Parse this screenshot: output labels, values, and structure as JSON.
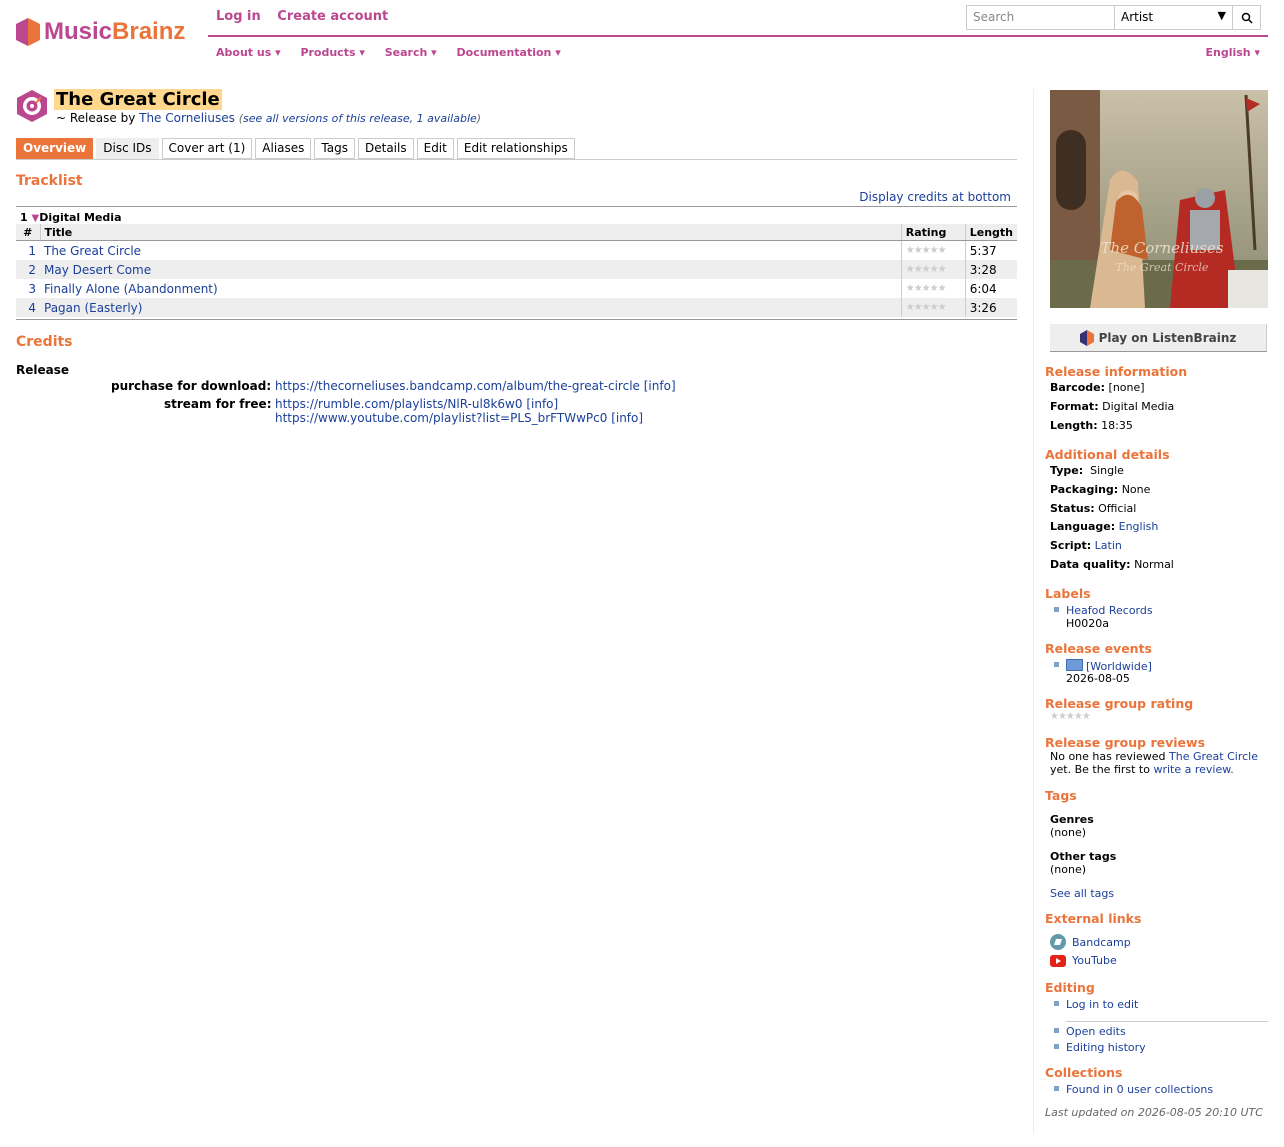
{
  "header": {
    "logo_part1": "Music",
    "logo_part2": "Brainz",
    "login": "Log in",
    "create_account": "Create account",
    "search_placeholder": "Search",
    "search_type": "Artist",
    "menu": [
      "About us ▾",
      "Products ▾",
      "Search ▾",
      "Documentation ▾"
    ],
    "language": "English ▾"
  },
  "release": {
    "title": "The Great Circle",
    "by_prefix": "~ Release by",
    "artist": "The Corneliuses",
    "versions": "see all versions of this release, 1 available",
    "tabs": [
      "Overview",
      "Disc IDs",
      "Cover art (1)",
      "Aliases",
      "Tags",
      "Details",
      "Edit",
      "Edit relationships"
    ]
  },
  "tracklist": {
    "heading": "Tracklist",
    "display_credits": "Display credits at bottom",
    "medium_num": "1",
    "medium_format": "Digital Media",
    "col_num": "#",
    "col_title": "Title",
    "col_rating": "Rating",
    "col_length": "Length",
    "stars": "★★★★★",
    "tracks": [
      {
        "num": "1",
        "title": "The Great Circle",
        "length": "5:37"
      },
      {
        "num": "2",
        "title": "May Desert Come",
        "length": "3:28"
      },
      {
        "num": "3",
        "title": "Finally Alone (Abandonment)",
        "length": "6:04"
      },
      {
        "num": "4",
        "title": "Pagan (Easterly)",
        "length": "3:26"
      }
    ]
  },
  "credits": {
    "heading": "Credits",
    "release_label": "Release",
    "purchase_label": "purchase for download:",
    "purchase_url": "https://thecorneliuses.bandcamp.com/album/the-great-circle",
    "stream_label": "stream for free:",
    "stream_url1": "https://rumble.com/playlists/NlR-ul8k6w0",
    "stream_url2": "https://www.youtube.com/playlist?list=PLS_brFTWwPc0",
    "info": "[info]"
  },
  "sidebar": {
    "cover_text1": "The Corneliuses",
    "cover_text2": "The Great Circle",
    "listenbrainz": "Play on ListenBrainz",
    "release_info_h": "Release information",
    "barcode_l": "Barcode:",
    "barcode_v": "[none]",
    "format_l": "Format:",
    "format_v": "Digital Media",
    "length_l": "Length:",
    "length_v": "18:35",
    "additional_h": "Additional details",
    "type_l": "Type:",
    "type_v": "Single",
    "packaging_l": "Packaging:",
    "packaging_v": "None",
    "status_l": "Status:",
    "status_v": "Official",
    "language_l": "Language:",
    "language_v": "English",
    "script_l": "Script:",
    "script_v": "Latin",
    "quality_l": "Data quality:",
    "quality_v": "Normal",
    "labels_h": "Labels",
    "label_name": "Heafod Records",
    "label_cat": "H0020a",
    "events_h": "Release events",
    "event_country": "[Worldwide]",
    "event_date": "2026-08-05",
    "rg_rating_h": "Release group rating",
    "rg_reviews_h": "Release group reviews",
    "reviews_text1": "No one has reviewed",
    "reviews_link1": "The Great Circle",
    "reviews_text2": "yet. Be the first to",
    "reviews_link2": "write a review.",
    "tags_h": "Tags",
    "genres_l": "Genres",
    "genres_v": "(none)",
    "other_tags_l": "Other tags",
    "other_tags_v": "(none)",
    "see_all_tags": "See all tags",
    "ext_links_h": "External links",
    "ext_bandcamp": "Bandcamp",
    "ext_youtube": "YouTube",
    "editing_h": "Editing",
    "log_in_to_edit": "Log in to edit",
    "open_edits": "Open edits",
    "editing_history": "Editing history",
    "collections_h": "Collections",
    "found_collections": "Found in 0 user collections",
    "last_updated": "Last updated on 2026-08-05 20:10 UTC"
  },
  "colors": {
    "brand_purple": "#ba478f",
    "brand_orange": "#eb743b",
    "link": "#1a3f9a"
  }
}
